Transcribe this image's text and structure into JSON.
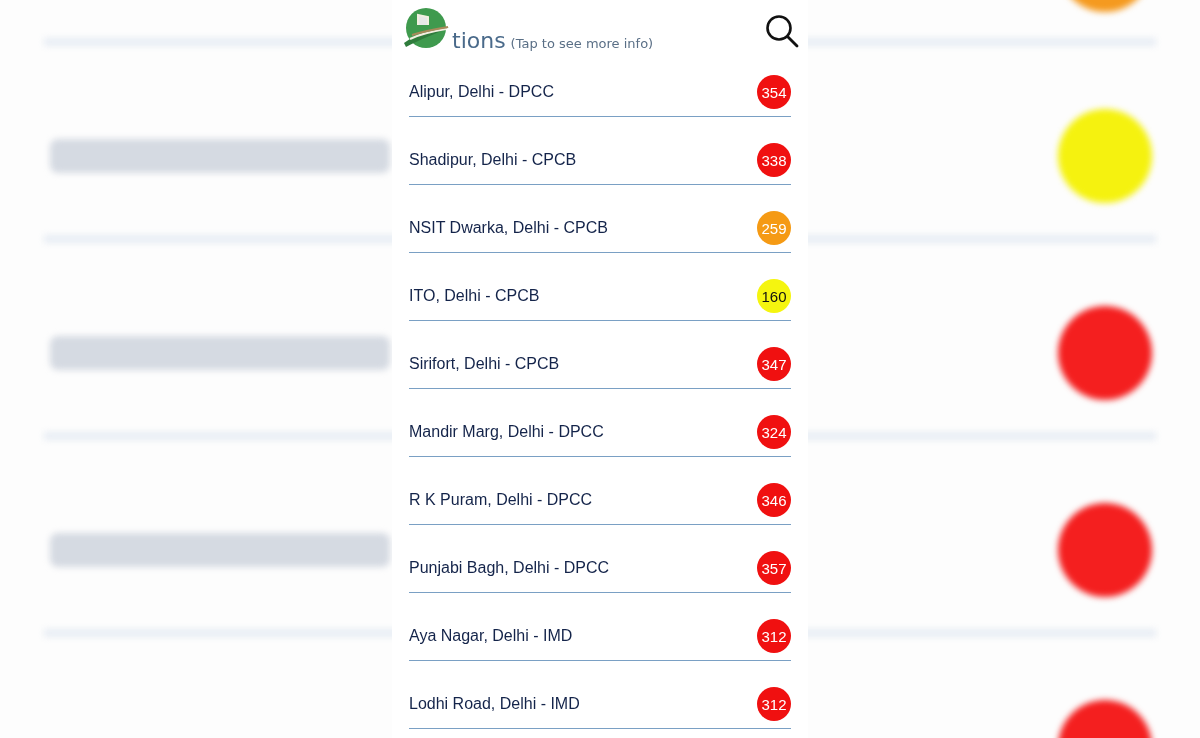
{
  "backdrop": {
    "rows": [
      {
        "color": "#f59a1f"
      },
      {
        "color": "#f5f20f"
      },
      {
        "color": "#f41f1f"
      },
      {
        "color": "#f41f1f"
      },
      {
        "color": "#f41f1f"
      }
    ]
  },
  "header": {
    "title": "tions",
    "hint": "(Tap to see more info)"
  },
  "stations": [
    {
      "name": "Alipur, Delhi - DPCC",
      "aqi": "354",
      "color": "#f01010"
    },
    {
      "name": "Shadipur, Delhi - CPCB",
      "aqi": "338",
      "color": "#f01010"
    },
    {
      "name": "NSIT Dwarka, Delhi - CPCB",
      "aqi": "259",
      "color": "#f59a14"
    },
    {
      "name": "ITO, Delhi - CPCB",
      "aqi": "160",
      "color": "#f5f50f"
    },
    {
      "name": "Sirifort, Delhi - CPCB",
      "aqi": "347",
      "color": "#f01010"
    },
    {
      "name": "Mandir Marg, Delhi - DPCC",
      "aqi": "324",
      "color": "#f01010"
    },
    {
      "name": "R K Puram, Delhi - DPCC",
      "aqi": "346",
      "color": "#f01010"
    },
    {
      "name": "Punjabi Bagh, Delhi - DPCC",
      "aqi": "357",
      "color": "#f01010"
    },
    {
      "name": "Aya Nagar, Delhi - IMD",
      "aqi": "312",
      "color": "#f01010"
    },
    {
      "name": "Lodhi Road, Delhi - IMD",
      "aqi": "312",
      "color": "#f01010"
    }
  ]
}
